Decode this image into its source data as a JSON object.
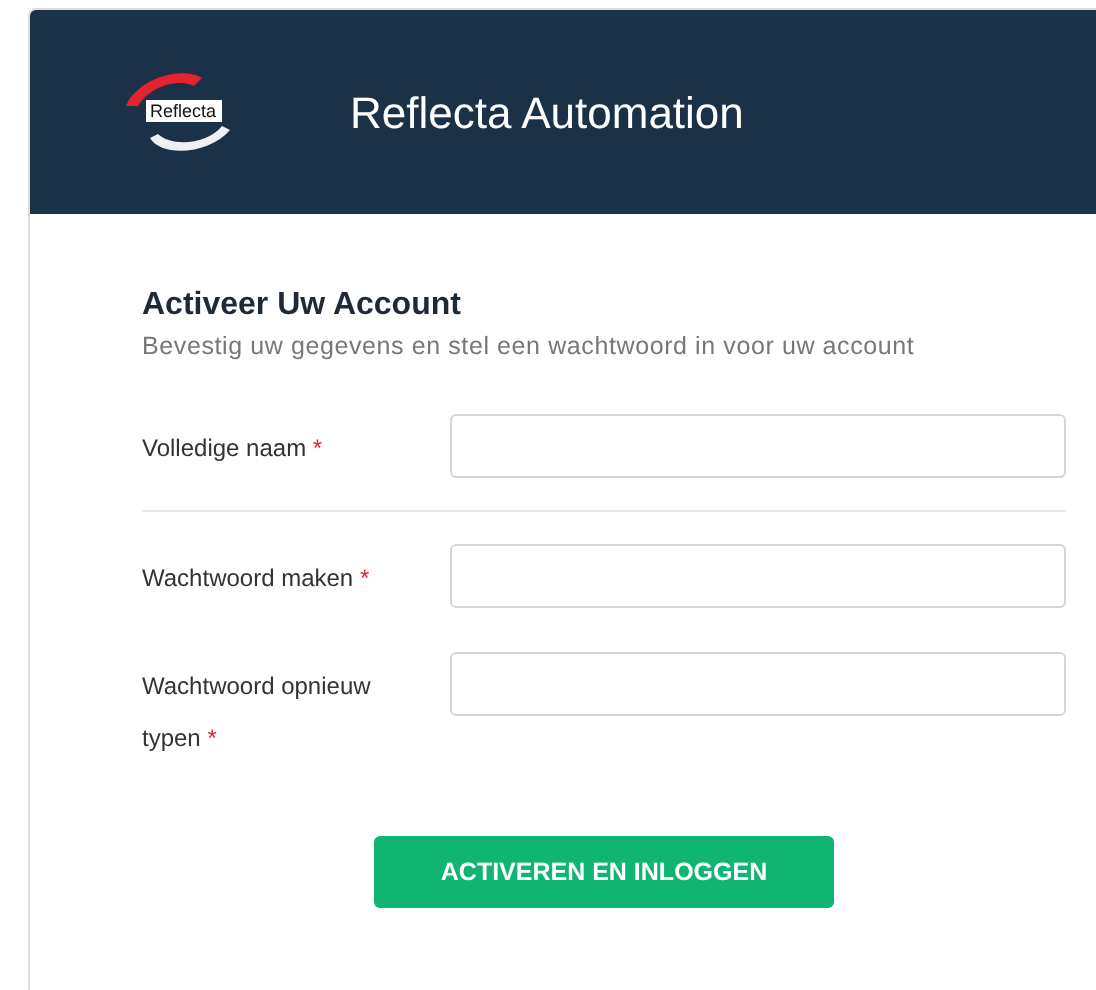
{
  "header": {
    "logo_text": "Reflecta",
    "title": "Reflecta Automation"
  },
  "form": {
    "title": "Activeer Uw Account",
    "subtitle": "Bevestig uw gegevens en stel een wachtwoord in voor uw account",
    "fields": [
      {
        "label": "Volledige naam",
        "required_mark": "*",
        "divider_after": true
      },
      {
        "label": "Wachtwoord maken",
        "required_mark": "*",
        "divider_after": false
      },
      {
        "label": "Wachtwoord opnieuw typen",
        "required_mark": "*",
        "divider_after": false
      }
    ],
    "submit": "ACTIVEREN EN INLOGGEN"
  }
}
